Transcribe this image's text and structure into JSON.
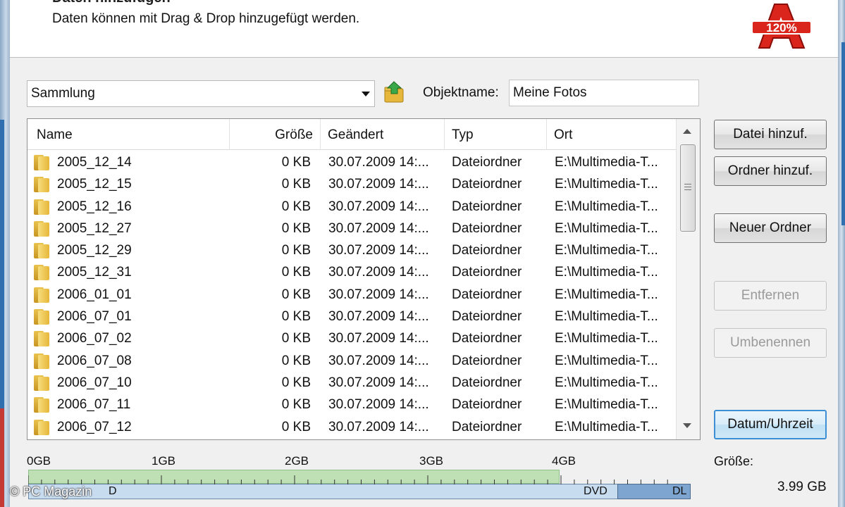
{
  "header": {
    "title": "Daten hinzufügen",
    "subtitle": "Daten können mit Drag & Drop hinzugefügt werden.",
    "logo_text": "120%"
  },
  "collection": {
    "selected": "Sammlung",
    "object_name_label": "Objektname:",
    "object_name_value": "Meine Fotos"
  },
  "list": {
    "columns": [
      "Name",
      "Größe",
      "Geändert",
      "Typ",
      "Ort"
    ],
    "rows": [
      {
        "name": "2005_12_14",
        "size": "0 KB",
        "modified": "30.07.2009 14:...",
        "type": "Dateiordner",
        "location": "E:\\Multimedia-T..."
      },
      {
        "name": "2005_12_15",
        "size": "0 KB",
        "modified": "30.07.2009 14:...",
        "type": "Dateiordner",
        "location": "E:\\Multimedia-T..."
      },
      {
        "name": "2005_12_16",
        "size": "0 KB",
        "modified": "30.07.2009 14:...",
        "type": "Dateiordner",
        "location": "E:\\Multimedia-T..."
      },
      {
        "name": "2005_12_27",
        "size": "0 KB",
        "modified": "30.07.2009 14:...",
        "type": "Dateiordner",
        "location": "E:\\Multimedia-T..."
      },
      {
        "name": "2005_12_29",
        "size": "0 KB",
        "modified": "30.07.2009 14:...",
        "type": "Dateiordner",
        "location": "E:\\Multimedia-T..."
      },
      {
        "name": "2005_12_31",
        "size": "0 KB",
        "modified": "30.07.2009 14:...",
        "type": "Dateiordner",
        "location": "E:\\Multimedia-T..."
      },
      {
        "name": "2006_01_01",
        "size": "0 KB",
        "modified": "30.07.2009 14:...",
        "type": "Dateiordner",
        "location": "E:\\Multimedia-T..."
      },
      {
        "name": "2006_07_01",
        "size": "0 KB",
        "modified": "30.07.2009 14:...",
        "type": "Dateiordner",
        "location": "E:\\Multimedia-T..."
      },
      {
        "name": "2006_07_02",
        "size": "0 KB",
        "modified": "30.07.2009 14:...",
        "type": "Dateiordner",
        "location": "E:\\Multimedia-T..."
      },
      {
        "name": "2006_07_08",
        "size": "0 KB",
        "modified": "30.07.2009 14:...",
        "type": "Dateiordner",
        "location": "E:\\Multimedia-T..."
      },
      {
        "name": "2006_07_10",
        "size": "0 KB",
        "modified": "30.07.2009 14:...",
        "type": "Dateiordner",
        "location": "E:\\Multimedia-T..."
      },
      {
        "name": "2006_07_11",
        "size": "0 KB",
        "modified": "30.07.2009 14:...",
        "type": "Dateiordner",
        "location": "E:\\Multimedia-T..."
      },
      {
        "name": "2006_07_12",
        "size": "0 KB",
        "modified": "30.07.2009 14:...",
        "type": "Dateiordner",
        "location": "E:\\Multimedia-T..."
      }
    ]
  },
  "buttons": {
    "add_file": "Datei hinzuf.",
    "add_folder": "Ordner hinzuf.",
    "new_folder": "Neuer Ordner",
    "remove": "Entfernen",
    "rename": "Umbenennen",
    "datetime": "Datum/Uhrzeit"
  },
  "capacity": {
    "ticks": [
      "0GB",
      "1GB",
      "2GB",
      "3GB",
      "4GB"
    ],
    "used_gb": 3.99,
    "cd_label": "D",
    "dvd_label": "DVD",
    "dl_label": "DL",
    "size_label": "Größe:",
    "size_value": "3.99 GB"
  },
  "watermark": "© PC Magazin",
  "colors": {
    "used_fill": "#bfe0b4",
    "media_fill": "#c8dcef",
    "dl_fill": "#7ea5cf",
    "focus": "#3c8fd4"
  }
}
